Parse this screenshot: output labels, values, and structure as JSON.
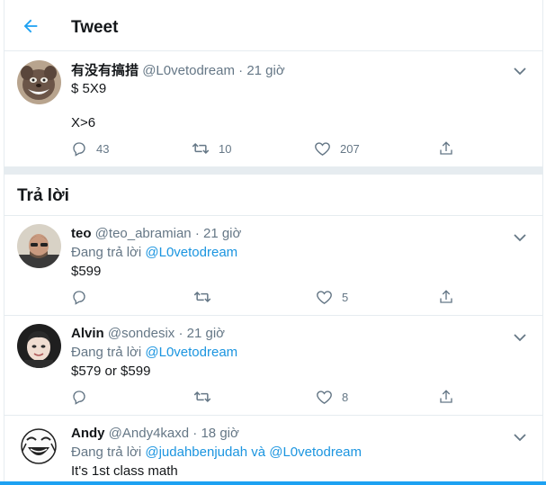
{
  "header": {
    "title": "Tweet"
  },
  "main_tweet": {
    "name": "有没有搞措",
    "handle": "@L0vetodream",
    "dot": "·",
    "time": "21 giờ",
    "line_a": "$ 5X9",
    "line_b": "X>6",
    "replies": "43",
    "retweets": "10",
    "likes": "207"
  },
  "section": {
    "title": "Trả lời"
  },
  "replies": [
    {
      "name": "teo",
      "handle": "@teo_abramian",
      "dot": "·",
      "time": "21 giờ",
      "reply_prefix": "Đang trả lời",
      "reply_to": "@L0vetodream",
      "text": "$599",
      "likes": "5"
    },
    {
      "name": "Alvin",
      "handle": "@sondesix",
      "dot": "·",
      "time": "21 giờ",
      "reply_prefix": "Đang trả lời",
      "reply_to": "@L0vetodream",
      "text": "$579 or $599",
      "likes": "8"
    },
    {
      "name": "Andy",
      "handle": "@Andy4kaxd",
      "dot": "·",
      "time": "18 giờ",
      "reply_prefix": "Đang trả lời",
      "reply_to": "@judahbenjudah",
      "conjunction": "và",
      "reply_to_2": "@L0vetodream",
      "text": "It's 1st class math"
    }
  ],
  "colors": {
    "accent": "#1da1f2",
    "link": "#1b95e0",
    "muted": "#657786",
    "divider": "#e6ecf0"
  },
  "icons": [
    "back-arrow-icon",
    "chevron-down-icon",
    "reply-icon",
    "retweet-icon",
    "like-icon",
    "share-icon"
  ]
}
